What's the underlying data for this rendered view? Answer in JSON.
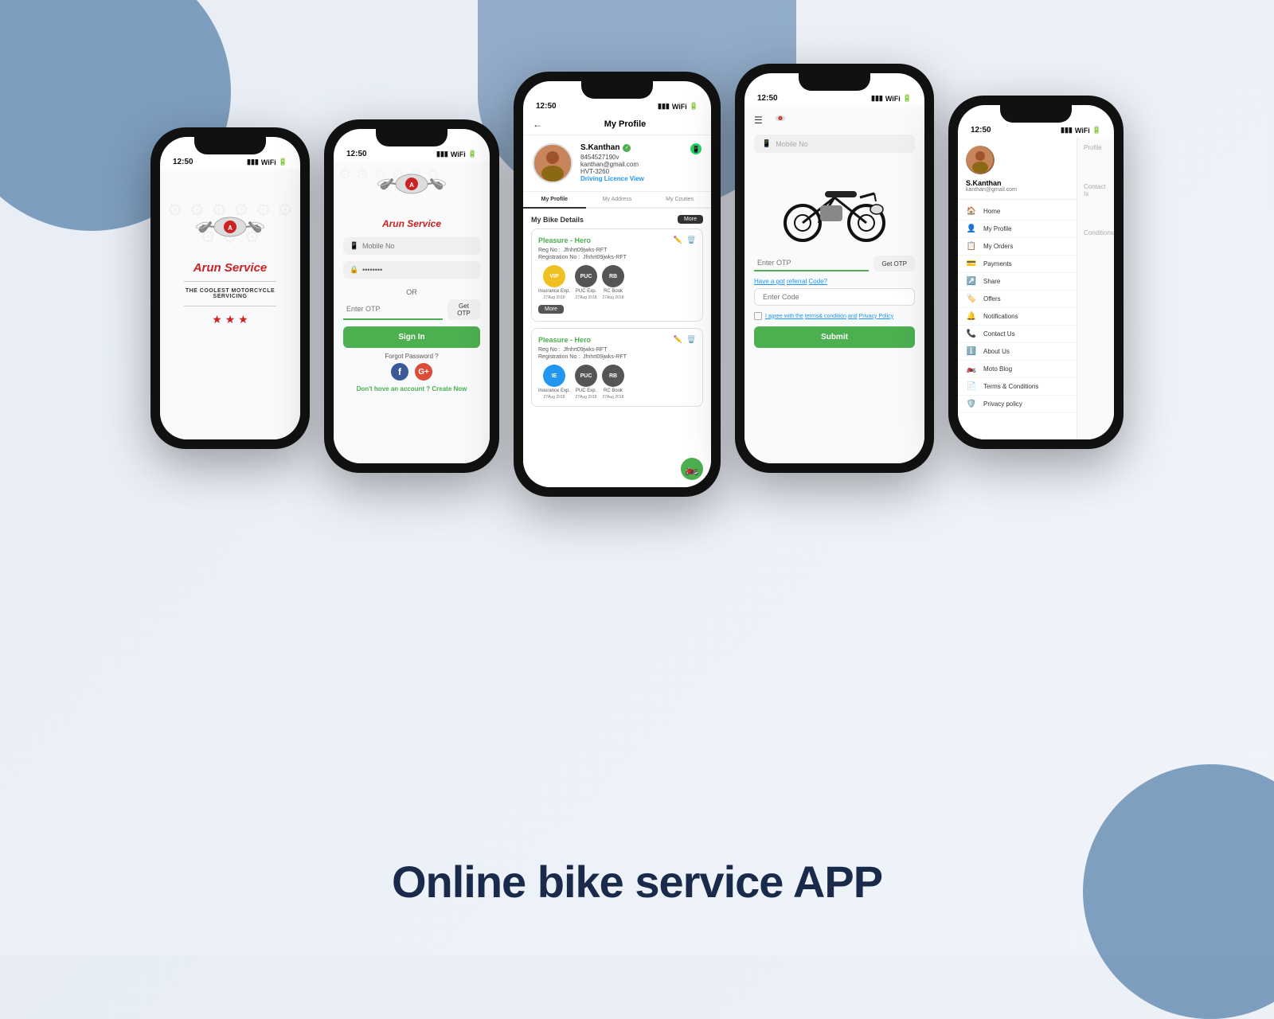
{
  "page": {
    "title": "Online bike service APP",
    "background_blob_color": "#6b8fb5"
  },
  "phone1": {
    "time": "12:50",
    "brand": "Arun Service",
    "tagline": "THE COOLEST MOTORCYCLE SERVICING",
    "stars": "★ ★ ★"
  },
  "phone2": {
    "time": "12:50",
    "brand": "Arun Service",
    "mobile_placeholder": "Mobile No",
    "password_placeholder": "••••••••",
    "or_text": "OR",
    "otp_placeholder": "Enter OTP",
    "get_otp_label": "Get OTP",
    "sign_in_label": "Sign In",
    "forgot_label": "Forgot Password ?",
    "no_account_text": "Don't hove an account ?",
    "create_now_label": "Create Now"
  },
  "phone3": {
    "time": "12:50",
    "title": "My Profile",
    "user_name": "S.Kanthan",
    "user_phone": "8454527190v",
    "user_email": "kanthan@gmail.com",
    "user_plate": "HVT-3260",
    "licence_label": "Driving Licence",
    "licence_action": "View",
    "tabs": [
      "My Profile",
      "My Address",
      "My Couties"
    ],
    "bike_section_title": "My Bike Details",
    "more_btn": "More",
    "bikes": [
      {
        "model": "Pleasure - Hero",
        "reg_no_label": "Reg No :",
        "reg_no": "Jfnhrt09jwks-RFT",
        "registration_label": "Registration No :",
        "registration": "Jfnhrt09jwks-RFT",
        "docs": [
          {
            "code": "VIP",
            "type": "Insurance Exp.",
            "date": "27Aug 2018",
            "color": "#f0c020"
          },
          {
            "code": "PUC",
            "type": "PUC Exp.",
            "date": "27Aug 2018",
            "color": "#555"
          },
          {
            "code": "RB",
            "type": "RC Book",
            "date": "27Aug 2018",
            "color": "#555"
          }
        ],
        "more": "More"
      },
      {
        "model": "Pleasure - Hero",
        "reg_no_label": "Reg No :",
        "reg_no": "Jfnhrt09jwks-RFT",
        "registration_label": "Registration No :",
        "registration": "Jfnhrt09jwks-RFT",
        "docs": [
          {
            "code": "IE",
            "type": "Insurance Exp.",
            "date": "27Aug 2018",
            "color": "#2196F3"
          },
          {
            "code": "PUC",
            "type": "PUC Exp.",
            "date": "27Aug 2018",
            "color": "#555"
          },
          {
            "code": "RB",
            "type": "RC Book",
            "date": "27Aug 2018",
            "color": "#555"
          }
        ]
      }
    ]
  },
  "phone4": {
    "time": "12:50",
    "mobile_placeholder": "Mobile No",
    "otp_placeholder": "Enter OTP",
    "get_otp_label": "Get OTP",
    "referral_label": "Have a got",
    "referral_link": "referral",
    "referral_suffix": "Code?",
    "code_placeholder": "Enter Code",
    "terms_text": "I agree with the",
    "terms_link1": "terms& condition",
    "terms_and": "and",
    "terms_link2": "Privacy Policy",
    "submit_label": "Submit"
  },
  "phone5": {
    "time": "12:50",
    "user_name": "S.Kanthan",
    "user_email": "kanthan@gmail.com",
    "menu_items": [
      {
        "icon": "🏠",
        "label": "Home"
      },
      {
        "icon": "👤",
        "label": "My Profile"
      },
      {
        "icon": "📋",
        "label": "My Orders"
      },
      {
        "icon": "💳",
        "label": "Payments"
      },
      {
        "icon": "↗️",
        "label": "Share"
      },
      {
        "icon": "🏷️",
        "label": "Offers"
      },
      {
        "icon": "🔔",
        "label": "Notifications"
      },
      {
        "icon": "📞",
        "label": "Contact Us"
      },
      {
        "icon": "ℹ️",
        "label": "About Us"
      },
      {
        "icon": "🏍️",
        "label": "Moto Blog"
      },
      {
        "icon": "📄",
        "label": "Terms & Conditions"
      },
      {
        "icon": "🛡️",
        "label": "Privacy policy"
      }
    ],
    "right_side_labels": [
      "Profile",
      "Contact Is",
      "Conditions"
    ]
  }
}
